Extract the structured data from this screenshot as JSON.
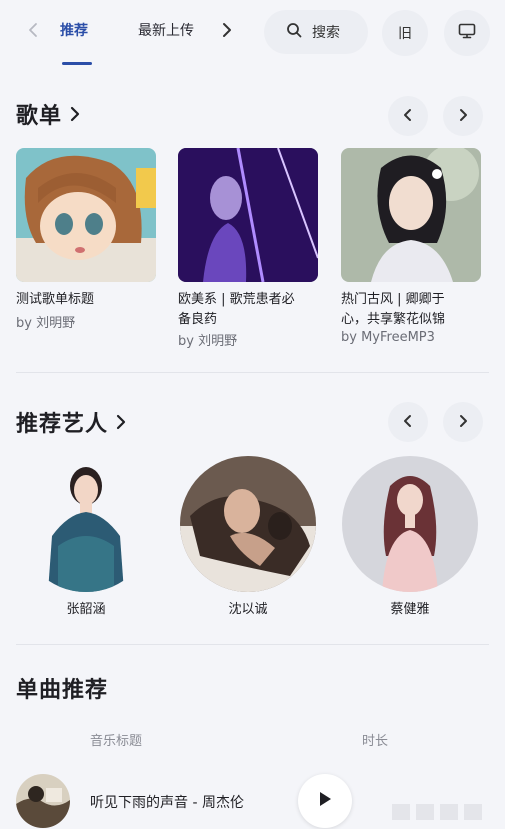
{
  "topbar": {
    "tabs": [
      "推荐",
      "最新上传"
    ],
    "search_label": "搜索",
    "circle_button_label": "旧"
  },
  "sections": {
    "playlists_title": "歌单",
    "artists_title": "推荐艺人",
    "songs_title": "单曲推荐"
  },
  "playlists": [
    {
      "title": "测试歌单标题",
      "by": "by 刘明野"
    },
    {
      "title_line1": "欧美系 | 歌荒患者必",
      "title_line2": "备良药",
      "by": "by 刘明野"
    },
    {
      "title_line1": "热门古风 | 卿卿于",
      "title_line2": "心，共享繁花似锦",
      "by": "by MyFreeMP3"
    }
  ],
  "artists": [
    {
      "name": "张韶涵"
    },
    {
      "name": "沈以诚"
    },
    {
      "name": "蔡健雅"
    }
  ],
  "songs": {
    "columns": [
      "音乐标题",
      "时长"
    ],
    "items": [
      {
        "title": "听见下雨的声音 - 周杰伦"
      }
    ]
  },
  "colors": {
    "accent": "#2b4ea8",
    "background": "#f4f5f9",
    "button_bg": "#eceef3"
  },
  "icons": [
    "back-arrow-icon",
    "chevron-right-icon",
    "search-icon",
    "monitor-icon",
    "play-icon"
  ]
}
